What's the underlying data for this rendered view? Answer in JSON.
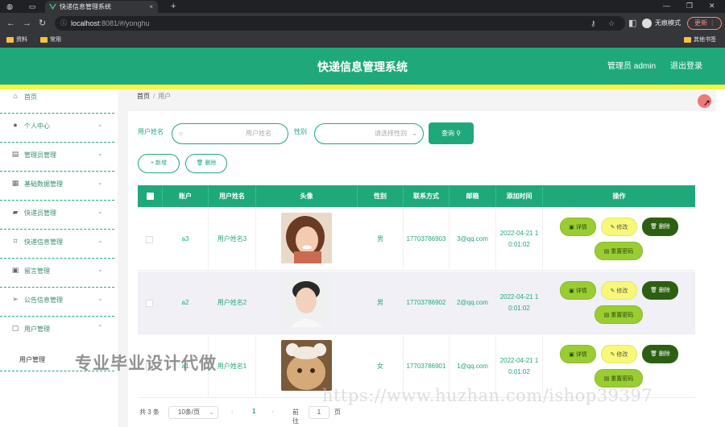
{
  "browser": {
    "tab_title": "快递信息管理系统",
    "url_host": "localhost",
    "url_path": ":8081/#/yonghu",
    "incognito_label": "无痕模式",
    "update_label": "更新",
    "bookmarks": [
      "资料",
      "常用"
    ],
    "bookmarks_right": "其他书签",
    "colors": {
      "chrome_dark": "#202124",
      "chrome": "#35363a"
    }
  },
  "header": {
    "title": "快递信息管理系统",
    "admin_label": "管理员 admin",
    "logout_label": "退出登录",
    "colors": {
      "primary": "#1fa97a",
      "accent_strip": "#f5f542"
    }
  },
  "sidebar": {
    "items": [
      {
        "label": "首页",
        "icon": "home-icon",
        "has_chevron": false
      },
      {
        "label": "个人中心",
        "icon": "user-icon",
        "has_chevron": true
      },
      {
        "label": "管理员管理",
        "icon": "clipboard-icon",
        "has_chevron": true
      },
      {
        "label": "基础数据管理",
        "icon": "grid-icon",
        "has_chevron": true
      },
      {
        "label": "快递员管理",
        "icon": "truck-icon",
        "has_chevron": true
      },
      {
        "label": "快递信息管理",
        "icon": "crop-icon",
        "has_chevron": true
      },
      {
        "label": "留言管理",
        "icon": "message-icon",
        "has_chevron": true
      },
      {
        "label": "公告信息管理",
        "icon": "send-icon",
        "has_chevron": true
      },
      {
        "label": "用户管理",
        "icon": "chat-icon",
        "has_chevron": true,
        "expanded": true
      }
    ],
    "submenu": {
      "label": "用户管理"
    }
  },
  "breadcrumb": {
    "home": "首页",
    "separator": "/",
    "current": "用户"
  },
  "search": {
    "name_label": "用户姓名",
    "name_placeholder": "用户姓名",
    "gender_label": "性别",
    "gender_placeholder": "请选择性别",
    "query_label": "查询"
  },
  "actions": {
    "add_label": "+ 新增",
    "delete_label": "删除"
  },
  "table": {
    "columns": [
      "账户",
      "用户姓名",
      "头像",
      "性别",
      "联系方式",
      "邮箱",
      "添加时间",
      "操作"
    ],
    "rows": [
      {
        "account": "a3",
        "name": "用户姓名3",
        "gender": "男",
        "phone": "17703786903",
        "email": "3@qq.com",
        "added": "2022-04-21 10:01:02"
      },
      {
        "account": "a2",
        "name": "用户姓名2",
        "gender": "男",
        "phone": "17703786902",
        "email": "2@qq.com",
        "added": "2022-04-21 10:01:02"
      },
      {
        "account": "a1",
        "name": "用户姓名1",
        "gender": "女",
        "phone": "17703786901",
        "email": "1@qq.com",
        "added": "2022-04-21 10:01:02"
      }
    ],
    "row_actions": {
      "detail": "详情",
      "edit": "修改",
      "delete": "删除",
      "reset": "重置密码"
    },
    "colors": {
      "detail": "#9acd32",
      "edit": "#f7f77a",
      "delete": "#2d5f12"
    }
  },
  "pagination": {
    "total": "共 3 条",
    "page_size": "10条/页",
    "current_page": "1",
    "goto_label": "前往",
    "goto_value": "1",
    "page_suffix": "页"
  },
  "watermark": {
    "cn": "专业毕业设计代做",
    "url": "https://www.huzhan.com/ishop39397"
  }
}
